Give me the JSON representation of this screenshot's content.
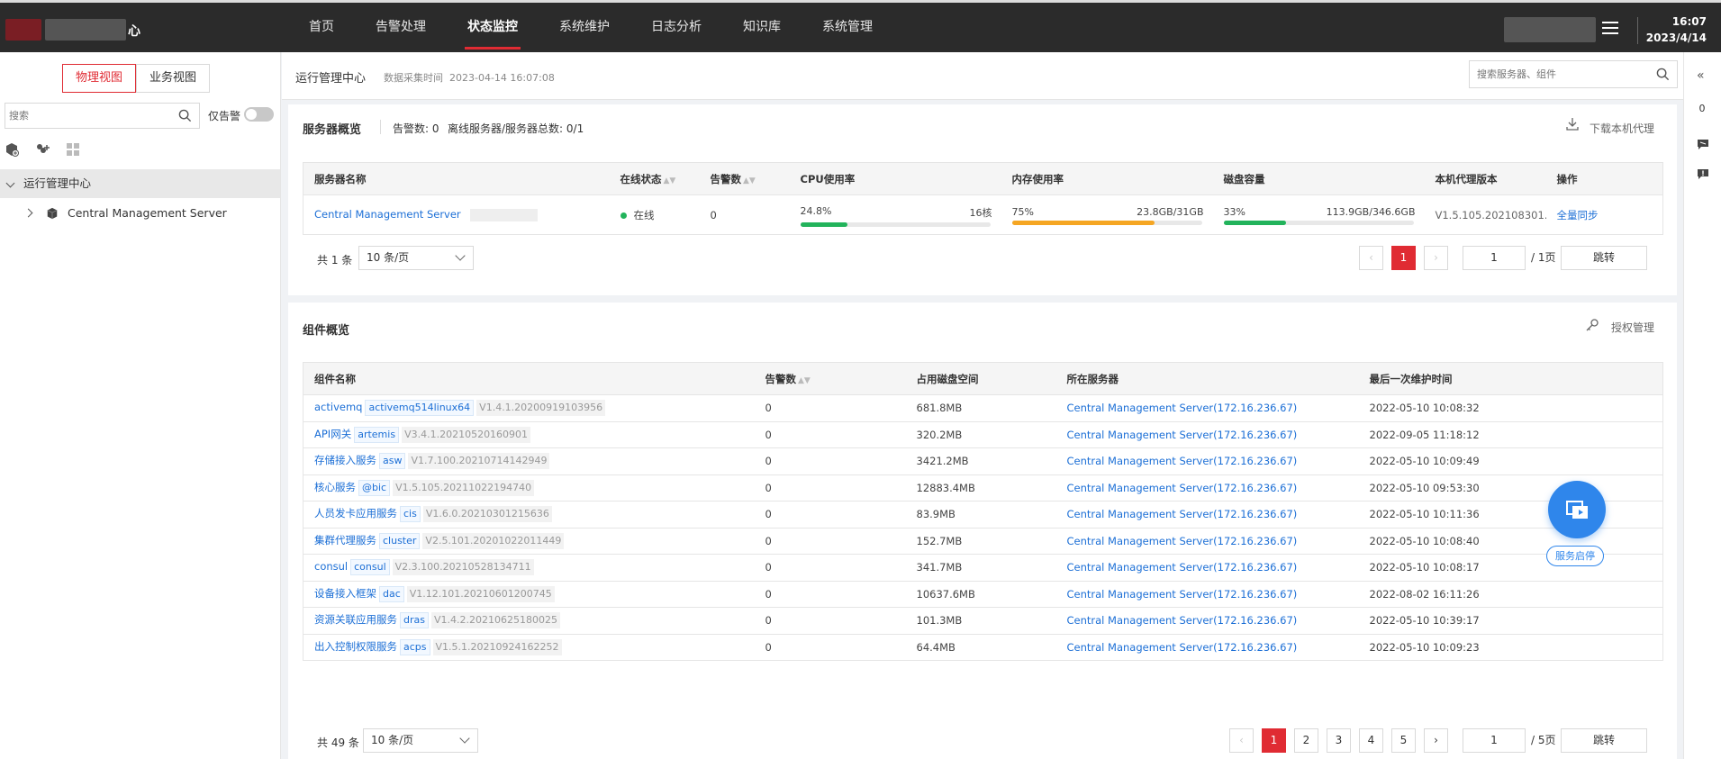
{
  "app": {
    "title_suffix": "心"
  },
  "topnav": [
    {
      "label": "首页",
      "active": false
    },
    {
      "label": "告警处理",
      "active": false
    },
    {
      "label": "状态监控",
      "active": true
    },
    {
      "label": "系统维护",
      "active": false
    },
    {
      "label": "日志分析",
      "active": false
    },
    {
      "label": "知识库",
      "active": false
    },
    {
      "label": "系统管理",
      "active": false
    }
  ],
  "clock": {
    "time": "16:07",
    "date": "2023/4/14"
  },
  "sidebar": {
    "tabs": [
      "物理视图",
      "业务视图"
    ],
    "search_placeholder": "搜索",
    "alarm_only_label": "仅告警",
    "tree": [
      {
        "label": "运行管理中心",
        "selected": true
      },
      {
        "label": "Central Management Server",
        "selected": false
      }
    ]
  },
  "header": {
    "title": "运行管理中心",
    "collect_time_label": "数据采集时间",
    "collect_time": "2023-04-14 16:07:08",
    "search_placeholder": "搜索服务器、组件"
  },
  "rightbar": {
    "count": "0"
  },
  "server_panel": {
    "title": "服务器概览",
    "alarm_count": "告警数: 0",
    "offline": "离线服务器/服务器总数: 0/1",
    "download_label": "下载本机代理",
    "columns": [
      "服务器名称",
      "在线状态",
      "告警数",
      "CPU使用率",
      "内存使用率",
      "磁盘容量",
      "本机代理版本",
      "操作"
    ],
    "row": {
      "name": "Central Management Server",
      "status": "在线",
      "alarms": "0",
      "cpu_pct": "24.8%",
      "cpu_detail": "16核",
      "cpu_value": 0.248,
      "mem_pct": "75%",
      "mem_detail": "23.8GB/31GB",
      "mem_value": 0.75,
      "disk_pct": "33%",
      "disk_detail": "113.9GB/346.6GB",
      "disk_value": 0.33,
      "agent_version": "V1.5.105.202108301...",
      "action": "全量同步"
    },
    "pager": {
      "total": "共 1 条",
      "size": "10 条/页",
      "pages": [
        "1"
      ],
      "current": "1",
      "total_pages": "/ 1页",
      "jump": "跳转"
    }
  },
  "component_panel": {
    "title": "组件概览",
    "auth_label": "授权管理",
    "columns": [
      "组件名称",
      "告警数",
      "占用磁盘空间",
      "所在服务器",
      "最后一次维护时间"
    ],
    "rows": [
      {
        "name": "activemq",
        "tag": "activemq514linux64",
        "ver": "V1.4.1.20200919103956",
        "alarms": "0",
        "disk": "681.8MB",
        "server": "Central Management Server(172.16.236.67)",
        "time": "2022-05-10 10:08:32"
      },
      {
        "name": "API网关",
        "tag": "artemis",
        "ver": "V3.4.1.20210520160901",
        "alarms": "0",
        "disk": "320.2MB",
        "server": "Central Management Server(172.16.236.67)",
        "time": "2022-09-05 11:18:12"
      },
      {
        "name": "存储接入服务",
        "tag": "asw",
        "ver": "V1.7.100.20210714142949",
        "alarms": "0",
        "disk": "3421.2MB",
        "server": "Central Management Server(172.16.236.67)",
        "time": "2022-05-10 10:09:49"
      },
      {
        "name": "核心服务",
        "tag": "@bic",
        "ver": "V1.5.105.20211022194740",
        "alarms": "0",
        "disk": "12883.4MB",
        "server": "Central Management Server(172.16.236.67)",
        "time": "2022-05-10 09:53:30"
      },
      {
        "name": "人员发卡应用服务",
        "tag": "cis",
        "ver": "V1.6.0.20210301215636",
        "alarms": "0",
        "disk": "83.9MB",
        "server": "Central Management Server(172.16.236.67)",
        "time": "2022-05-10 10:11:36"
      },
      {
        "name": "集群代理服务",
        "tag": "cluster",
        "ver": "V2.5.101.20201022011449",
        "alarms": "0",
        "disk": "152.7MB",
        "server": "Central Management Server(172.16.236.67)",
        "time": "2022-05-10 10:08:40"
      },
      {
        "name": "consul",
        "tag": "consul",
        "ver": "V2.3.100.20210528134711",
        "alarms": "0",
        "disk": "341.7MB",
        "server": "Central Management Server(172.16.236.67)",
        "time": "2022-05-10 10:08:17"
      },
      {
        "name": "设备接入框架",
        "tag": "dac",
        "ver": "V1.12.101.20210601200745",
        "alarms": "0",
        "disk": "10637.6MB",
        "server": "Central Management Server(172.16.236.67)",
        "time": "2022-08-02 16:11:26"
      },
      {
        "name": "资源关联应用服务",
        "tag": "dras",
        "ver": "V1.4.2.20210625180025",
        "alarms": "0",
        "disk": "101.3MB",
        "server": "Central Management Server(172.16.236.67)",
        "time": "2022-05-10 10:39:17"
      },
      {
        "name": "出入控制权限服务",
        "tag": "acps",
        "ver": "V1.5.1.20210924162252",
        "alarms": "0",
        "disk": "64.4MB",
        "server": "Central Management Server(172.16.236.67)",
        "time": "2022-05-10 10:09:23"
      }
    ],
    "pager": {
      "total": "共 49 条",
      "size": "10 条/页",
      "pages": [
        "1",
        "2",
        "3",
        "4",
        "5"
      ],
      "current": "1",
      "total_pages": "/ 5页",
      "jump": "跳转"
    }
  },
  "float_button": {
    "label": "服务启停"
  },
  "colors": {
    "accent": "#e02b33",
    "link": "#1c6fd6",
    "cpu": "#22b35b",
    "mem": "#f5a623",
    "disk": "#22b35b",
    "float": "#2f86eb"
  }
}
